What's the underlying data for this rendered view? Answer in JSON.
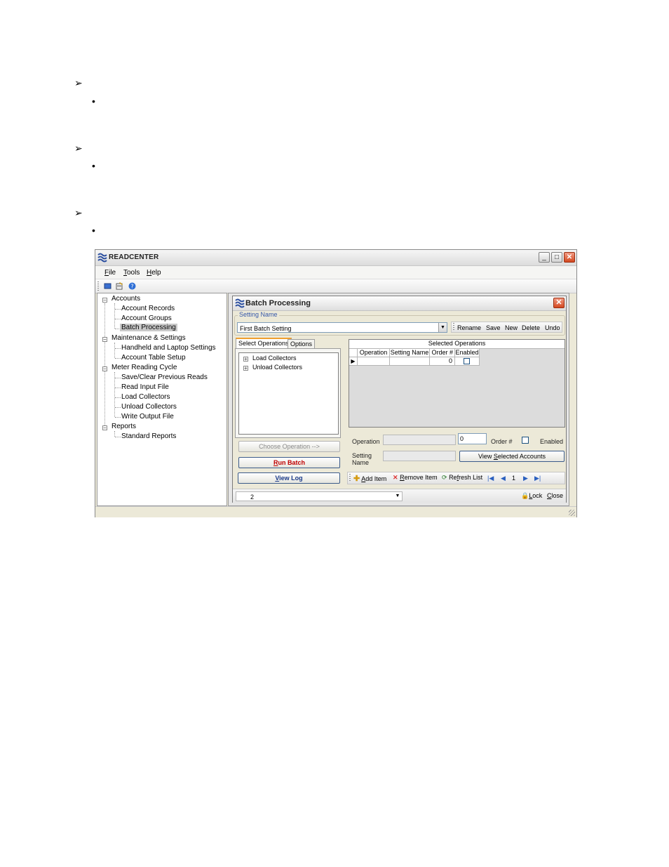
{
  "document": {
    "markers": [
      {
        "type": "arrow",
        "glyph": "➢"
      },
      {
        "type": "bullet",
        "glyph": "•"
      },
      {
        "type": "arrow",
        "glyph": "➢"
      },
      {
        "type": "bullet",
        "glyph": "•"
      },
      {
        "type": "arrow",
        "glyph": "➢"
      },
      {
        "type": "bullet",
        "glyph": "•"
      }
    ]
  },
  "window": {
    "title": "READCENTER",
    "buttons": {
      "minimize": "_",
      "maximize": "□",
      "close": "✕"
    }
  },
  "menu": [
    {
      "accel": "F",
      "rest": "ile"
    },
    {
      "accel": "T",
      "rest": "ools"
    },
    {
      "accel": "H",
      "rest": "elp"
    }
  ],
  "toolbar": {
    "icons": [
      "window-icon",
      "properties-icon",
      "help-icon"
    ]
  },
  "tree": {
    "groups": [
      {
        "label": "Accounts",
        "expander": "−",
        "children": [
          "Account Records",
          "Account Groups",
          "Batch Processing"
        ]
      },
      {
        "label": "Maintenance & Settings",
        "expander": "−",
        "children": [
          "Handheld and Laptop Settings",
          "Account Table Setup"
        ]
      },
      {
        "label": "Meter Reading Cycle",
        "expander": "−",
        "children": [
          "Save/Clear Previous Reads",
          "Read Input File",
          "Load Collectors",
          "Unload Collectors",
          "Write Output File"
        ]
      },
      {
        "label": "Reports",
        "expander": "−",
        "children": [
          "Standard Reports"
        ]
      }
    ],
    "selected": "Batch Processing"
  },
  "batch": {
    "title": "Batch Processing",
    "close": "✕",
    "setting_legend": "Setting Name",
    "setting_value": "First Batch Setting",
    "combo_arrow": "▼",
    "actions": [
      "Rename",
      "Save",
      "New",
      "Delete",
      "Undo"
    ],
    "tabs": [
      "Select Operations",
      "Options"
    ],
    "operations": [
      {
        "expander": "+",
        "label": "Load Collectors"
      },
      {
        "expander": "+",
        "label": "Unload Collectors"
      }
    ],
    "choose_button": "Choose Operation -->",
    "run_button": {
      "accel": "R",
      "rest": "un Batch"
    },
    "log_button": {
      "accel": "V",
      "rest": "iew Log"
    },
    "grid": {
      "title": "Selected Operations",
      "columns": [
        "Operation",
        "Setting Name",
        "Order #",
        "Enabled"
      ],
      "row": {
        "operation": "",
        "setting": "",
        "order": "0",
        "enabled": false
      },
      "row_indicator": "▶"
    },
    "form": {
      "operation_label": "Operation",
      "order_value": "0",
      "order_label": "Order #",
      "enabled_label": "Enabled",
      "setting_label_1": "Setting",
      "setting_label_2": "Name",
      "view_accounts": {
        "pre": "View ",
        "accel": "S",
        "rest": "elected Accounts"
      }
    },
    "item_actions": {
      "add": {
        "accel": "A",
        "rest": "dd Item"
      },
      "remove": {
        "accel": "R",
        "rest": "emove Item"
      },
      "refresh": {
        "pre": "Re",
        "accel": "f",
        "rest": "resh List"
      },
      "page": "1",
      "nav": [
        "|◀",
        "◀",
        "▶",
        "▶|"
      ]
    },
    "footer": {
      "page_value": "2",
      "lock": {
        "accel": "L",
        "rest": "ock"
      },
      "close": {
        "accel": "C",
        "rest": "lose"
      }
    }
  },
  "colors": {
    "accent": "#3557a8",
    "close_red": "#d3481f",
    "run_batch": "#c00000",
    "view_log": "#1a3a8a",
    "tab_highlight": "#f0a030"
  }
}
